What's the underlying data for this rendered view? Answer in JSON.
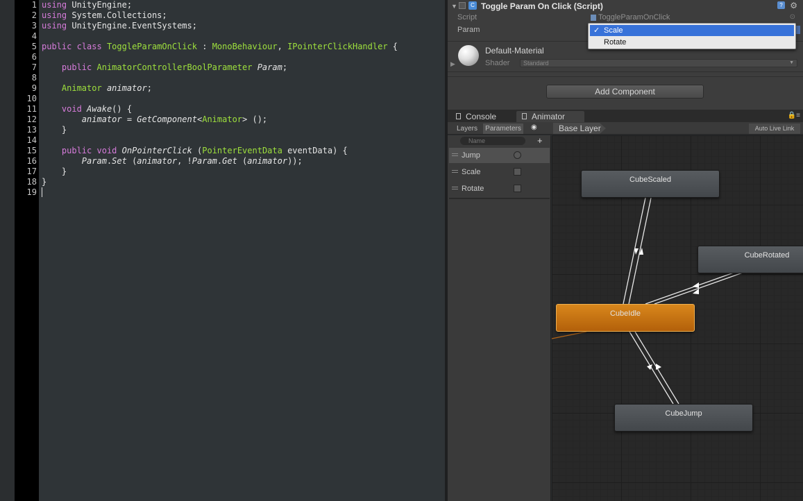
{
  "editor": {
    "line_numbers": [
      "1",
      "2",
      "3",
      "4",
      "5",
      "6",
      "7",
      "8",
      "9",
      "10",
      "11",
      "12",
      "13",
      "14",
      "15",
      "16",
      "17",
      "18",
      "19"
    ],
    "lines": [
      [
        {
          "t": "using",
          "c": "kw"
        },
        {
          "t": " UnityEngine;"
        }
      ],
      [
        {
          "t": "using",
          "c": "kw"
        },
        {
          "t": " System.Collections;"
        }
      ],
      [
        {
          "t": "using",
          "c": "kw"
        },
        {
          "t": " UnityEngine.EventSystems;"
        }
      ],
      [],
      [
        {
          "t": "public",
          "c": "kw"
        },
        {
          "t": " "
        },
        {
          "t": "class",
          "c": "kw"
        },
        {
          "t": " "
        },
        {
          "t": "ToggleParamOnClick",
          "c": "ty"
        },
        {
          "t": " : "
        },
        {
          "t": "MonoBehaviour",
          "c": "ty"
        },
        {
          "t": ", "
        },
        {
          "t": "IPointerClickHandler",
          "c": "ty"
        },
        {
          "t": " {"
        }
      ],
      [],
      [
        {
          "t": "    "
        },
        {
          "t": "public",
          "c": "kw"
        },
        {
          "t": " "
        },
        {
          "t": "AnimatorControllerBoolParameter",
          "c": "ty"
        },
        {
          "t": " "
        },
        {
          "t": "Param",
          "c": "it"
        },
        {
          "t": ";"
        }
      ],
      [],
      [
        {
          "t": "    "
        },
        {
          "t": "Animator",
          "c": "ty"
        },
        {
          "t": " "
        },
        {
          "t": "animator",
          "c": "it"
        },
        {
          "t": ";"
        }
      ],
      [],
      [
        {
          "t": "    "
        },
        {
          "t": "void",
          "c": "kw"
        },
        {
          "t": " "
        },
        {
          "t": "Awake",
          "c": "it"
        },
        {
          "t": "() {"
        }
      ],
      [
        {
          "t": "        "
        },
        {
          "t": "animator",
          "c": "it"
        },
        {
          "t": " = "
        },
        {
          "t": "GetComponent",
          "c": "it"
        },
        {
          "t": "<"
        },
        {
          "t": "Animator",
          "c": "ty"
        },
        {
          "t": "> ();"
        }
      ],
      [
        {
          "t": "    }"
        }
      ],
      [],
      [
        {
          "t": "    "
        },
        {
          "t": "public",
          "c": "kw"
        },
        {
          "t": " "
        },
        {
          "t": "void",
          "c": "kw"
        },
        {
          "t": " "
        },
        {
          "t": "OnPointerClick",
          "c": "it"
        },
        {
          "t": " ("
        },
        {
          "t": "PointerEventData",
          "c": "ty"
        },
        {
          "t": " eventData) {"
        }
      ],
      [
        {
          "t": "        "
        },
        {
          "t": "Param",
          "c": "it"
        },
        {
          "t": "."
        },
        {
          "t": "Set",
          "c": "it"
        },
        {
          "t": " ("
        },
        {
          "t": "animator",
          "c": "it"
        },
        {
          "t": ", !"
        },
        {
          "t": "Param",
          "c": "it"
        },
        {
          "t": "."
        },
        {
          "t": "Get",
          "c": "it"
        },
        {
          "t": " ("
        },
        {
          "t": "animator",
          "c": "it"
        },
        {
          "t": "));"
        }
      ],
      [
        {
          "t": "    }"
        }
      ],
      [
        {
          "t": "}"
        }
      ],
      []
    ]
  },
  "inspector": {
    "component_title": "Toggle Param On Click (Script)",
    "script_label": "Script",
    "script_value": "ToggleParamOnClick",
    "param_label": "Param",
    "dropdown": {
      "options": [
        "Scale",
        "Rotate"
      ],
      "selected": "Scale",
      "check": "✓"
    },
    "material_name": "Default-Material",
    "shader_label": "Shader",
    "shader_value": "Standard",
    "add_component": "Add Component"
  },
  "tabs": {
    "console": "Console",
    "animator": "Animator"
  },
  "animator": {
    "layers_btn": "Layers",
    "parameters_btn": "Parameters",
    "breadcrumb": "Base Layer",
    "auto_live_link": "Auto Live Link",
    "search_placeholder": "Name",
    "add_symbol": "+",
    "parameters": [
      {
        "name": "Jump",
        "kind": "trigger"
      },
      {
        "name": "Scale",
        "kind": "bool"
      },
      {
        "name": "Rotate",
        "kind": "bool"
      }
    ],
    "states": {
      "scaled": "CubeScaled",
      "rotated": "CubeRotated",
      "idle": "CubeIdle",
      "jump": "CubeJump"
    }
  },
  "colors": {
    "keyword": "#d77cdb",
    "type": "#9ee03d",
    "selection_blue": "#3772d9",
    "active_state": "#c7740f"
  }
}
